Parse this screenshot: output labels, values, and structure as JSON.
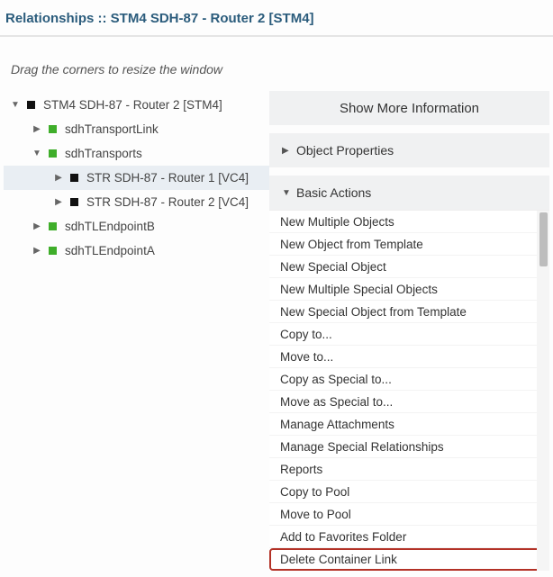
{
  "header": {
    "title": "Relationships :: STM4 SDH-87 - Router 2 [STM4]"
  },
  "hint": "Drag the corners to resize the window",
  "tree": {
    "nodes": [
      {
        "level": 0,
        "caret": "down",
        "color": "black",
        "label": "STM4 SDH-87 - Router 2 [STM4]",
        "selected": false
      },
      {
        "level": 1,
        "caret": "right",
        "color": "green",
        "label": "sdhTransportLink",
        "selected": false
      },
      {
        "level": 1,
        "caret": "down",
        "color": "green",
        "label": "sdhTransports",
        "selected": false
      },
      {
        "level": 2,
        "caret": "right",
        "color": "black",
        "label": "STR SDH-87 - Router 1 [VC4]",
        "selected": true
      },
      {
        "level": 2,
        "caret": "right",
        "color": "black",
        "label": "STR SDH-87 - Router 2 [VC4]",
        "selected": false
      },
      {
        "level": 1,
        "caret": "right",
        "color": "green",
        "label": "sdhTLEndpointB",
        "selected": false
      },
      {
        "level": 1,
        "caret": "right",
        "color": "green",
        "label": "sdhTLEndpointA",
        "selected": false
      }
    ]
  },
  "right": {
    "show_more_label": "Show More Information",
    "object_properties_label": "Object Properties",
    "basic_actions_label": "Basic Actions",
    "actions": [
      {
        "label": "New Multiple Objects",
        "highlight": false
      },
      {
        "label": "New Object from Template",
        "highlight": false
      },
      {
        "label": "New Special Object",
        "highlight": false
      },
      {
        "label": "New Multiple Special Objects",
        "highlight": false
      },
      {
        "label": "New Special Object from Template",
        "highlight": false
      },
      {
        "label": "Copy to...",
        "highlight": false
      },
      {
        "label": "Move to...",
        "highlight": false
      },
      {
        "label": "Copy as Special to...",
        "highlight": false
      },
      {
        "label": "Move as Special to...",
        "highlight": false
      },
      {
        "label": "Manage Attachments",
        "highlight": false
      },
      {
        "label": "Manage Special Relationships",
        "highlight": false
      },
      {
        "label": "Reports",
        "highlight": false
      },
      {
        "label": "Copy to Pool",
        "highlight": false
      },
      {
        "label": "Move to Pool",
        "highlight": false
      },
      {
        "label": "Add to Favorites Folder",
        "highlight": false
      },
      {
        "label": "Delete Container Link",
        "highlight": true
      }
    ]
  }
}
